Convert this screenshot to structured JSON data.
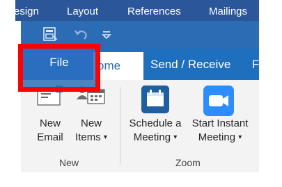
{
  "word_ribbon": {
    "tabs": [
      "esign",
      "Layout",
      "References",
      "Mailings"
    ]
  },
  "quick_access": {
    "icons": [
      "send-receive-icon",
      "undo-icon",
      "customize-toolbar-icon"
    ]
  },
  "tabs": {
    "file": "File",
    "home": "ome",
    "send_receive": "Send / Receive",
    "partial": "Fo"
  },
  "ribbon": {
    "new_group": {
      "label": "New",
      "new_email_line1": "New",
      "new_email_line2": "Email",
      "new_items_line1": "New",
      "new_items_line2": "Items",
      "new_items_chevron": "▾"
    },
    "zoom_group": {
      "label": "Zoom",
      "schedule_line1": "Schedule a",
      "schedule_line2": "Meeting",
      "schedule_chevron": "▾",
      "instant_line1": "Start Instant",
      "instant_line2": "Meeting",
      "instant_chevron": "▾"
    }
  },
  "colors": {
    "word_blue": "#2b579a",
    "outlook_blue": "#1f6fbf",
    "highlight_red": "#ff0000",
    "zoom_blue": "#2d8cff",
    "calendar_blue": "#1f5f9f"
  }
}
